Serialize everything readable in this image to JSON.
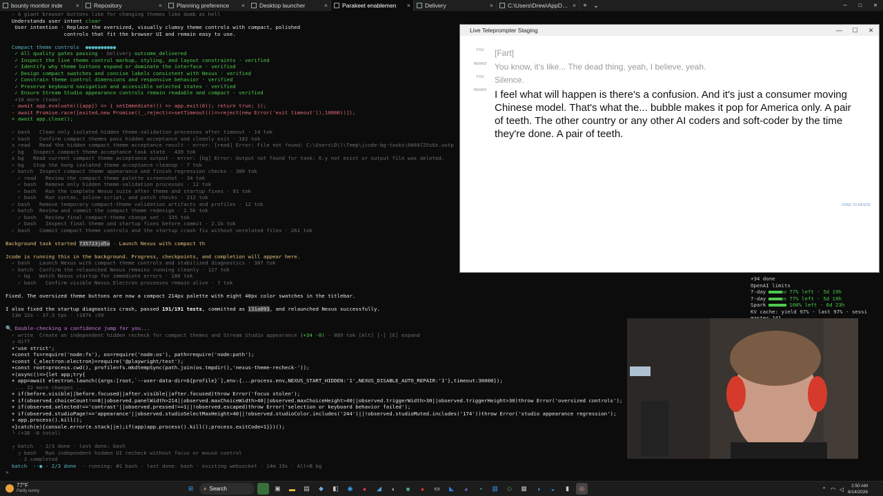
{
  "tabs": [
    {
      "label": "bounty monitor inde",
      "active": false
    },
    {
      "label": "Repository",
      "active": false
    },
    {
      "label": "Planning preference",
      "active": false
    },
    {
      "label": "Desktop launcher",
      "active": false
    },
    {
      "label": "Parakeet enablemen",
      "active": true
    },
    {
      "label": "Delivery",
      "active": false
    },
    {
      "label": "C:\\Users\\Drew\\AppData\\",
      "active": false
    }
  ],
  "terminal": {
    "lines": [
      [
        {
          "t": "  › A giant browser buttons like for changing themes like dumb as hell",
          "c": "gr"
        }
      ],
      [
        {
          "t": "  Understands user intent ",
          "c": "w"
        },
        {
          "t": "clear",
          "c": "g"
        }
      ],
      [
        {
          "t": "   User intention · Replace the oversized, visually clumsy theme controls with compact, polished",
          "c": "w"
        }
      ],
      [
        {
          "t": "                   controls that fit the browser UI and remain easy to use.",
          "c": "w"
        }
      ],
      [
        {
          "t": "",
          "c": "w"
        }
      ],
      [
        {
          "t": "  Compact theme controls  ●●●●●●●●●●",
          "c": "c"
        }
      ],
      [
        {
          "t": "   ✓ All quality gates passing",
          "c": "g"
        },
        {
          "t": " · Delivery ",
          "c": "gr"
        },
        {
          "t": "outcome_delivered",
          "c": "g"
        }
      ],
      [
        {
          "t": "   ✓ Inspect the live theme control markup, styling, and layout constraints · ",
          "c": "g"
        },
        {
          "t": "verified",
          "c": "g"
        }
      ],
      [
        {
          "t": "   ✓ Identify why theme buttons expand or dominate the interface · verified",
          "c": "g"
        }
      ],
      [
        {
          "t": "   ✓ Design compact swatches and concise labels consistent with Nexus · verified",
          "c": "g"
        }
      ],
      [
        {
          "t": "   ✓ Constrain theme control dimensions and responsive behavior · verified",
          "c": "g"
        }
      ],
      [
        {
          "t": "   ✓ Preserve keyboard navigation and accessible selected states · verified",
          "c": "g"
        }
      ],
      [
        {
          "t": "   ✓ Ensure Stream Studio appearance controls remain readable and compact · verified",
          "c": "g"
        }
      ],
      [
        {
          "t": "   +10 more (todo)",
          "c": "gr"
        }
      ],
      [
        {
          "t": "  - await app.evaluate(({app}) => { setImmediate(() => app.exit(0)); return true; });",
          "c": "r"
        }
      ],
      [
        {
          "t": "  - await Promise.race([exited,new Promise((_,reject)=>setTimeout(()=>reject(new Error('exit timeout')),10000))]);",
          "c": "r"
        }
      ],
      [
        {
          "t": "  + await app.close();",
          "c": "g"
        }
      ],
      [
        {
          "t": "",
          "c": "w"
        }
      ],
      [
        {
          "t": "  ✓ bash   Clean only isolated hidden theme-validation processes after timeout · 14 tok",
          "c": "gr"
        }
      ],
      [
        {
          "t": "  ✓ bash   Confirm compact themes pass hidden acceptance and cleanly exit · 182 tok",
          "c": "gr"
        }
      ],
      [
        {
          "t": "  x read   Read the hidden compact theme acceptance result",
          "c": "gr"
        },
        {
          "t": " · error: [read] Error: File not found: C:\\Users\\D\\l\\Temp\\jcode-bg-tasks\\6669725s0z.outp",
          "c": "gr"
        }
      ],
      [
        {
          "t": "  ✓ bg   Inspect compact theme acceptance task state · 439 tok",
          "c": "gr"
        }
      ],
      [
        {
          "t": "  x bg   Read current compact theme acceptance output",
          "c": "gr"
        },
        {
          "t": " · error: [bg] Error: Output not found for task: 6.y not exist or output file was deleted.",
          "c": "gr"
        }
      ],
      [
        {
          "t": "  ✓ bg   Stop the hung isolated theme acceptance cleanup · 7 tok",
          "c": "gr"
        }
      ],
      [
        {
          "t": "  ✓ batch  Inspect compact theme appearance and finish regression checks · 380 tok",
          "c": "gr"
        }
      ],
      [
        {
          "t": "    ✓ read   Review the compact theme palette screenshot · 34 tok",
          "c": "gr"
        }
      ],
      [
        {
          "t": "    ✓ bash   Remove only hidden theme-validation processes · 12 tok",
          "c": "gr"
        }
      ],
      [
        {
          "t": "    ✓ bash   Run the complete Nexus suite after theme and startup fixes · 91 tok",
          "c": "gr"
        }
      ],
      [
        {
          "t": "    ✓ bash   Run syntax, inline-script, and patch checks · 212 tok",
          "c": "gr"
        }
      ],
      [
        {
          "t": "  ✓ bash   Remove temporary compact-theme validation artifacts and profiles · 12 tok",
          "c": "gr"
        }
      ],
      [
        {
          "t": "  ✓ batch  Review and commit the compact theme redesign · 2.5k tok",
          "c": "gr"
        }
      ],
      [
        {
          "t": "    ✓ bash   Review final compact-theme change set · 335 tok",
          "c": "gr"
        }
      ],
      [
        {
          "t": "    ✓ bash   Inspect final theme and startup fixes before commit · 2.1k tok",
          "c": "gr"
        }
      ],
      [
        {
          "t": "  ✓ bash   Commit compact theme controls and the startup crash fix without unrelated files · 261 tok",
          "c": "gr"
        }
      ],
      [
        {
          "t": "",
          "c": "w"
        }
      ],
      [
        {
          "t": "Background task started ",
          "c": "y"
        },
        {
          "t": "735723jd5a",
          "c": "hl"
        },
        {
          "t": " · ",
          "c": "gr"
        },
        {
          "t": "Launch Nexus with compact th",
          "c": "y"
        }
      ],
      [
        {
          "t": "",
          "c": "w"
        }
      ],
      [
        {
          "t": "Jcode is running this in the background. Progress, checkpoints, and completion will appear here.",
          "c": "y"
        }
      ],
      [
        {
          "t": "  ✓ bash   Launch Nexus with compact theme controls and stabilized diagnostics · 387 tok",
          "c": "gr"
        }
      ],
      [
        {
          "t": "  ✓ batch  Confirm the relaunched Nexus remains running cleanly · 127 tok",
          "c": "gr"
        }
      ],
      [
        {
          "t": "    ✓ bg   Watch Nexus startup for immediate errors · 180 tok",
          "c": "gr"
        }
      ],
      [
        {
          "t": "    ✓ bash   Confirm visible Nexus Electron processes remain alive · 7 tok",
          "c": "gr"
        }
      ],
      [
        {
          "t": "",
          "c": "w"
        }
      ],
      [
        {
          "t": "Fixed. The oversized theme buttons are now a compact 214px palette with eight 40px color swatches in the titlebar.",
          "c": "w"
        }
      ],
      [
        {
          "t": "",
          "c": "w"
        }
      ],
      [
        {
          "t": "I also fixed the startup diagnostics crash, passed ",
          "c": "w"
        },
        {
          "t": "191/191 tests",
          "c": "bold"
        },
        {
          "t": ", committed as ",
          "c": "w"
        },
        {
          "t": "131a093",
          "c": "hl"
        },
        {
          "t": ", and relaunched Nexus successfully.",
          "c": "w"
        }
      ],
      [
        {
          "t": "  13m 32s · 37.3 tps · ↑187k ↓59",
          "c": "gr"
        }
      ],
      [
        {
          "t": "",
          "c": "w"
        }
      ],
      [
        {
          "t": "🔍 Double-checking a confidence jump for you...",
          "c": "m"
        }
      ],
      [
        {
          "t": "  ✓ write  Create an independent hidden recheck for compact themes and Stream Studio appearance ",
          "c": "gr"
        },
        {
          "t": "(+34 -0)",
          "c": "g"
        },
        {
          "t": " · 889 tok [Alt] [-] [E] expand",
          "c": "gr"
        }
      ],
      [
        {
          "t": "  ┌ diff",
          "c": "gr"
        }
      ],
      [
        {
          "t": "  +'use strict';",
          "c": "w"
        }
      ],
      [
        {
          "t": "  +const fs=require('node:fs'), os=require('node:os'), path=require('node:path');",
          "c": "w"
        }
      ],
      [
        {
          "t": "  +const {_electron:electron}=require('@playwright/test');",
          "c": "w"
        }
      ],
      [
        {
          "t": "  +const root=process.cwd(), profile=fs.mkdtempSync(path.join(os.tmpdir(),'nexus-theme-recheck-'));",
          "c": "w"
        }
      ],
      [
        {
          "t": "  +(async()=>{let app;try{",
          "c": "w"
        }
      ],
      [
        {
          "t": "  + app=await electron.launch({args:[root,`--user-data-dir=${profile}`],env:{...process.env,NEXUS_START_HIDDEN:'1',NEXUS_DISABLE_AUTO_REPAIR:'1'},timeout:30000});",
          "c": "w"
        }
      ],
      [
        {
          "t": "   ... 22 more changes ...",
          "c": "gr"
        }
      ],
      [
        {
          "t": "  + if(before.visible||before.focused||after.visible||after.focused)throw Error('focus stolen');",
          "c": "w"
        }
      ],
      [
        {
          "t": "  + if(observed.choiceCount!==8||observed.panelWidth>214||observed.maxChoiceWidth>40||observed.maxChoiceHeight>40||observed.triggerWidth>30||observed.triggerHeight>30)throw Error('oversized controls');",
          "c": "w"
        }
      ],
      [
        {
          "t": "  + if(observed.selected!=='contrast'||observed.pressed!==1||!observed.escaped)throw Error('selection or keyboard behavior failed');",
          "c": "w"
        }
      ],
      [
        {
          "t": "  + if(observed.studioPage!=='appearance'||observed.studioSelectMaxHeight>40||!observed.studioColor.includes('244')||!observed.studioMuted.includes('174'))throw Error('studio appearance regression');",
          "c": "w"
        }
      ],
      [
        {
          "t": "  + app.process().kill();",
          "c": "w"
        }
      ],
      [
        {
          "t": "  +}catch(e){console.error(e.stack||e);if(app)app.process().kill();process.exitCode=1}})();",
          "c": "w"
        }
      ],
      [
        {
          "t": "  └ (+36 -0 total)",
          "c": "gr"
        }
      ],
      [
        {
          "t": "",
          "c": "w"
        }
      ],
      [
        {
          "t": "  ┌ batch  · 2/3 done · last done: bash",
          "c": "gr"
        }
      ],
      [
        {
          "t": "    ┌ bash   Run independent hidden UI recheck without focus or mouse control",
          "c": "gr"
        }
      ],
      [
        {
          "t": "    · 2 completed",
          "c": "gr"
        }
      ],
      [
        {
          "t": "  batch  ··● · 2/3 done",
          "c": "c"
        },
        {
          "t": "  · running: #1 bash · last done: bash · existing websocket · 14m 19s · Alt+B bg",
          "c": "gr"
        }
      ],
      [
        {
          "t": "> ",
          "c": "c"
        }
      ]
    ]
  },
  "teleprompter": {
    "title": "Live Teleprompter Staging",
    "lines": [
      {
        "who": "YOU",
        "text": "[Fart]",
        "style": "dim"
      },
      {
        "who": "HEARD",
        "text": "You know, it's like... The dead thing, yeah, I believe, yeah.",
        "style": "dim"
      },
      {
        "who": "YOU",
        "text": "Silence.",
        "style": "dim"
      },
      {
        "who": "HEARD",
        "text": "I feel what will happen is there's a confusion. And it's just a consumer moving Chinese model. That's what the... bubble makes it pop for America only. A pair of teeth. The other country or any other AI coders and soft-coder by the time they're done. A pair of teeth.",
        "style": "main"
      }
    ],
    "resize_hint": "DRAG TO RESIZE"
  },
  "usage": {
    "lines": [
      {
        "text": "+34 done",
        "kind": "plain"
      },
      {
        "text": "OpenAI limits",
        "kind": "plain"
      },
      {
        "label": "7-day",
        "fill": 0.77,
        "status": "77% left · 5d 19h",
        "kind": "bar"
      },
      {
        "label": "7-day",
        "fill": 0.77,
        "status": "77% left · 5d 19h",
        "kind": "bar"
      },
      {
        "label": "Spark",
        "fill": 1.0,
        "status": "100% left · 6d 23h",
        "kind": "bar"
      },
      {
        "text": "KV cache: yield 97% · last 97% · sessi",
        "kind": "plain"
      },
      {
        "text": "master ?41",
        "kind": "plain"
      }
    ]
  },
  "taskbar": {
    "temperature": "77°F",
    "weather": "Partly sunny",
    "search": "Search",
    "time": "2:50 AM",
    "date": "6/14/2026"
  }
}
